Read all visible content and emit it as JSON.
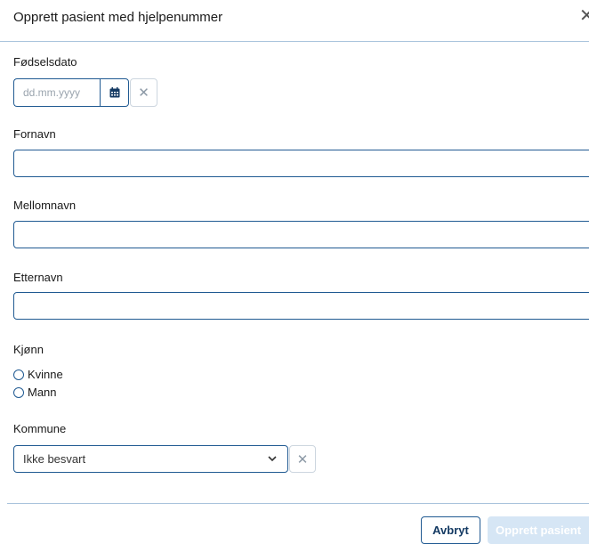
{
  "dialog": {
    "title": "Opprett pasient med hjelpenummer",
    "close_symbol": "✕"
  },
  "birthdate": {
    "label": "Fødselsdato",
    "placeholder": "dd.mm.yyyy",
    "value": "",
    "calendar_icon": "calendar-icon",
    "clear_symbol": "✕"
  },
  "first_name": {
    "label": "Fornavn",
    "value": ""
  },
  "middle_name": {
    "label": "Mellomnavn",
    "value": ""
  },
  "last_name": {
    "label": "Etternavn",
    "value": ""
  },
  "gender": {
    "label": "Kjønn",
    "options": [
      "Kvinne",
      "Mann"
    ]
  },
  "municipality": {
    "label": "Kommune",
    "selected": "Ikke besvart",
    "clear_symbol": "✕"
  },
  "footer": {
    "cancel_label": "Avbryt",
    "submit_label": "Opprett pasient"
  },
  "colors": {
    "primary": "#205a92",
    "divider": "#a9c3dc",
    "disabled_button": "#d6e6f5"
  }
}
